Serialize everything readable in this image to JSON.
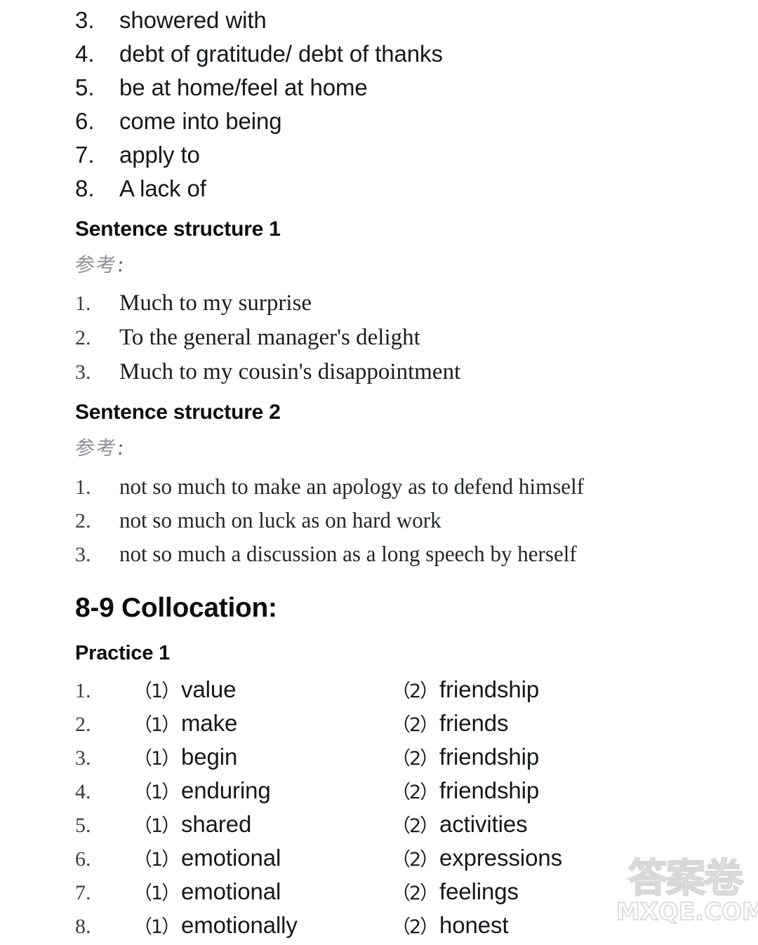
{
  "page": {
    "background_color": "#ffffff",
    "text_color": "#15181a"
  },
  "idiom_list": {
    "items": [
      {
        "num": "3.",
        "text": "showered with"
      },
      {
        "num": "4.",
        "text": "debt of gratitude/ debt of thanks"
      },
      {
        "num": "5.",
        "text": "be at home/feel at home"
      },
      {
        "num": "6.",
        "text": "come into being"
      },
      {
        "num": "7.",
        "text": "apply to"
      },
      {
        "num": "8.",
        "text": "A lack of"
      }
    ]
  },
  "sentence_structure_1": {
    "heading": "Sentence structure 1",
    "reference_label": "参考",
    "reference_colon": ":",
    "items": [
      {
        "num": "1.",
        "text": "Much to my surprise"
      },
      {
        "num": "2.",
        "text": "To the general manager's delight"
      },
      {
        "num": "3.",
        "text": "Much to my cousin's disappointment"
      }
    ]
  },
  "sentence_structure_2": {
    "heading": "Sentence structure 2",
    "reference_label": "参考",
    "reference_colon": ":",
    "items": [
      {
        "num": "1.",
        "text": "not so much to make an apology as to defend himself"
      },
      {
        "num": "2.",
        "text": "not so much on luck as on hard work"
      },
      {
        "num": "3.",
        "text": "not so much a discussion as a long speech by herself"
      }
    ]
  },
  "collocation": {
    "heading": "8-9 Collocation:",
    "practice_heading": "Practice 1",
    "rows": [
      {
        "num": "1.",
        "p1": "（1）",
        "a1": "value",
        "p2": "（2）",
        "a2": "friendship"
      },
      {
        "num": "2.",
        "p1": "（1）",
        "a1": "make",
        "p2": "（2）",
        "a2": "friends"
      },
      {
        "num": "3.",
        "p1": "（1）",
        "a1": "begin",
        "p2": "（2）",
        "a2": "friendship"
      },
      {
        "num": "4.",
        "p1": "（1）",
        "a1": "enduring",
        "p2": "（2）",
        "a2": "friendship"
      },
      {
        "num": "5.",
        "p1": "（1）",
        "a1": "shared",
        "p2": "（2）",
        "a2": "activities"
      },
      {
        "num": "6.",
        "p1": "（1）",
        "a1": "emotional",
        "p2": "（2）",
        "a2": "expressions"
      },
      {
        "num": "7.",
        "p1": "（1）",
        "a1": "emotional",
        "p2": "（2）",
        "a2": "feelings"
      },
      {
        "num": "8.",
        "p1": "（1）",
        "a1": "emotionally",
        "p2": "（2）",
        "a2": "honest"
      }
    ]
  },
  "watermark": {
    "cjk_text": "答案卷",
    "domain_text": "MXQE.COM",
    "color": "#dcdcdc"
  }
}
